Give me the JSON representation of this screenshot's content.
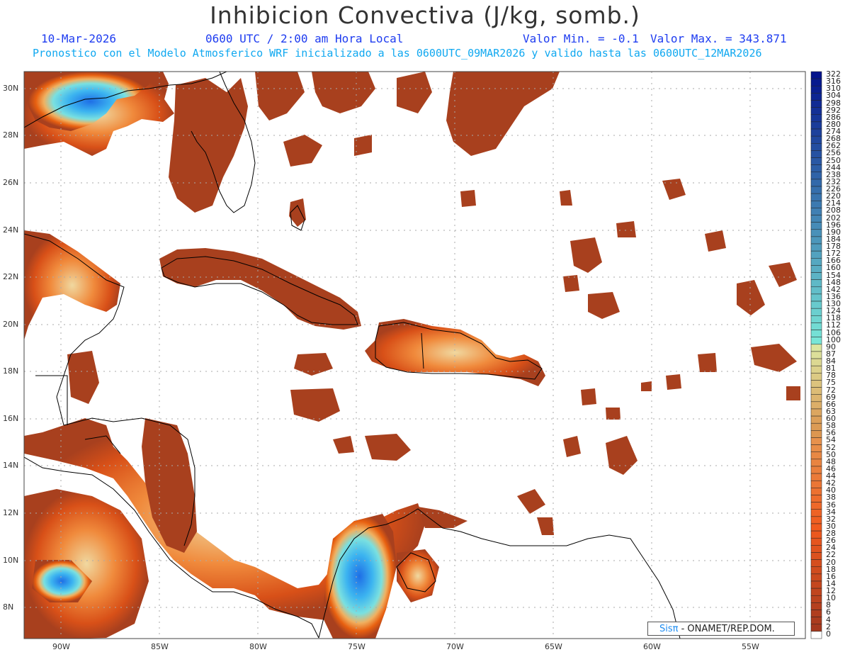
{
  "header": {
    "title": "Inhibicion Convectiva (J/kg, somb.)",
    "date": "10-Mar-2026",
    "time": "0600 UTC / 2:00 am Hora Local",
    "valmin": "Valor Min. = -0.1",
    "valmax": "Valor Max. = 343.871",
    "subtitle": "Pronostico con el Modelo Atmosferico WRF inicializado a las 0600UTC_09MAR2026 y valido hasta las  0600UTC_12MAR2026"
  },
  "lat_ticks": [
    "30N",
    "28N",
    "26N",
    "24N",
    "22N",
    "20N",
    "18N",
    "16N",
    "14N",
    "12N",
    "10N",
    "8N"
  ],
  "lon_ticks": [
    "90W",
    "85W",
    "80W",
    "75W",
    "70W",
    "65W",
    "60W",
    "55W"
  ],
  "colorbar": {
    "labels": [
      "322",
      "316",
      "310",
      "304",
      "298",
      "292",
      "286",
      "280",
      "274",
      "268",
      "262",
      "256",
      "250",
      "244",
      "238",
      "232",
      "226",
      "220",
      "214",
      "208",
      "202",
      "196",
      "190",
      "184",
      "178",
      "172",
      "166",
      "160",
      "154",
      "148",
      "142",
      "136",
      "130",
      "124",
      "118",
      "112",
      "106",
      "100",
      "90",
      "87",
      "84",
      "81",
      "78",
      "75",
      "72",
      "69",
      "66",
      "63",
      "60",
      "58",
      "56",
      "54",
      "52",
      "50",
      "48",
      "46",
      "44",
      "42",
      "40",
      "38",
      "36",
      "34",
      "32",
      "30",
      "28",
      "26",
      "24",
      "22",
      "20",
      "18",
      "16",
      "14",
      "12",
      "10",
      "8",
      "6",
      "4",
      "2",
      "0"
    ]
  },
  "credit": {
    "sis": "Sisπ",
    "text": " - ONAMET/REP.DOM."
  }
}
